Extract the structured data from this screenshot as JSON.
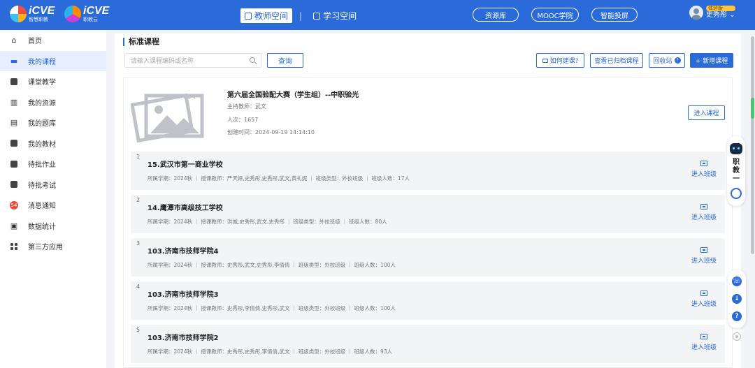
{
  "topbar": {
    "logo1": {
      "main": "iCVE",
      "sub": "智慧职教"
    },
    "logo2": {
      "main": "iCVE",
      "sub": "职教云"
    },
    "space_tabs": [
      {
        "label": "教师空间",
        "active": true
      },
      {
        "label": "学习空间",
        "active": false
      }
    ],
    "pills": [
      "资源库",
      "MOOC学院",
      "智能投屏"
    ],
    "user": {
      "badge": "体验版",
      "name": "史秀彤"
    }
  },
  "sidebar": {
    "items": [
      {
        "label": "首页",
        "icon": "home-icon",
        "active": false
      },
      {
        "label": "我的课程",
        "icon": "book-icon",
        "active": true
      },
      {
        "label": "课堂教学",
        "icon": "classroom-icon",
        "active": false
      },
      {
        "label": "我的资源",
        "icon": "resource-icon",
        "active": false
      },
      {
        "label": "我的题库",
        "icon": "question-bank-icon",
        "active": false
      },
      {
        "label": "我的教材",
        "icon": "textbook-icon",
        "active": false
      },
      {
        "label": "待批作业",
        "icon": "homework-icon",
        "active": false
      },
      {
        "label": "待批考试",
        "icon": "exam-icon",
        "active": false
      },
      {
        "label": "消息通知",
        "icon": "message-icon",
        "active": false,
        "badge": "54"
      },
      {
        "label": "数据统计",
        "icon": "stats-icon",
        "active": false
      },
      {
        "label": "第三方应用",
        "icon": "apps-icon",
        "active": false
      }
    ]
  },
  "main": {
    "section_title": "标准课程",
    "search_placeholder": "请输入课程编码或名称",
    "query_label": "查询",
    "how_to_build": "如何建课?",
    "view_archived": "查看已归档课程",
    "recycle_bin": "回收站",
    "recycle_help": "?",
    "add_course": "+ 新增课程",
    "course": {
      "title": "第六届全国验配大赛（学生组）--中职验光",
      "host": "主持教师：武文",
      "count": "人次：1657",
      "created": "创建时间：2024-09-19 14:14:10",
      "enter_label": "进入课程"
    },
    "enter_class_label": "进入班级",
    "classes": [
      {
        "index": "1",
        "name": "15.武汉市第一商业学校",
        "info": "所属学期：2024秋  ｜  授课教师：严天妍,史秀彤,史秀彤,武文,黄礼妮  ｜  班级类型：外校班级  ｜  班级人数：17人"
      },
      {
        "index": "2",
        "name": "14.鹰潭市高级技工学校",
        "info": "所属学期：2024秋  ｜  授课教师：洪城,史秀彤,武文,史秀彤  ｜  班级类型：外校班级  ｜  班级人数：80人"
      },
      {
        "index": "3",
        "name": "103.济南市技师学院4",
        "info": "所属学期：2024秋  ｜  授课教师：史秀彤,武文,史秀彤,李倩倩  ｜  班级类型：外校班级  ｜  班级人数：100人"
      },
      {
        "index": "4",
        "name": "103.济南市技师学院3",
        "info": "所属学期：2024秋  ｜  授课教师：史秀彤,李倩倩,史秀彤,武文  ｜  班级类型：外校班级  ｜  班级人数：100人"
      },
      {
        "index": "5",
        "name": "103.济南市技师学院2",
        "info": "所属学期：2024秋  ｜  授课教师：史秀彤,史秀彤,李倩倩,武文  ｜  班级类型：外校班级  ｜  班级人数：93人"
      }
    ]
  },
  "float_panel": {
    "vertical_text": "职教一"
  },
  "colors": {
    "primary": "#2a6ad9",
    "sidebar_active_bg": "#e6efff",
    "row_bg": "#f3f4f6"
  }
}
